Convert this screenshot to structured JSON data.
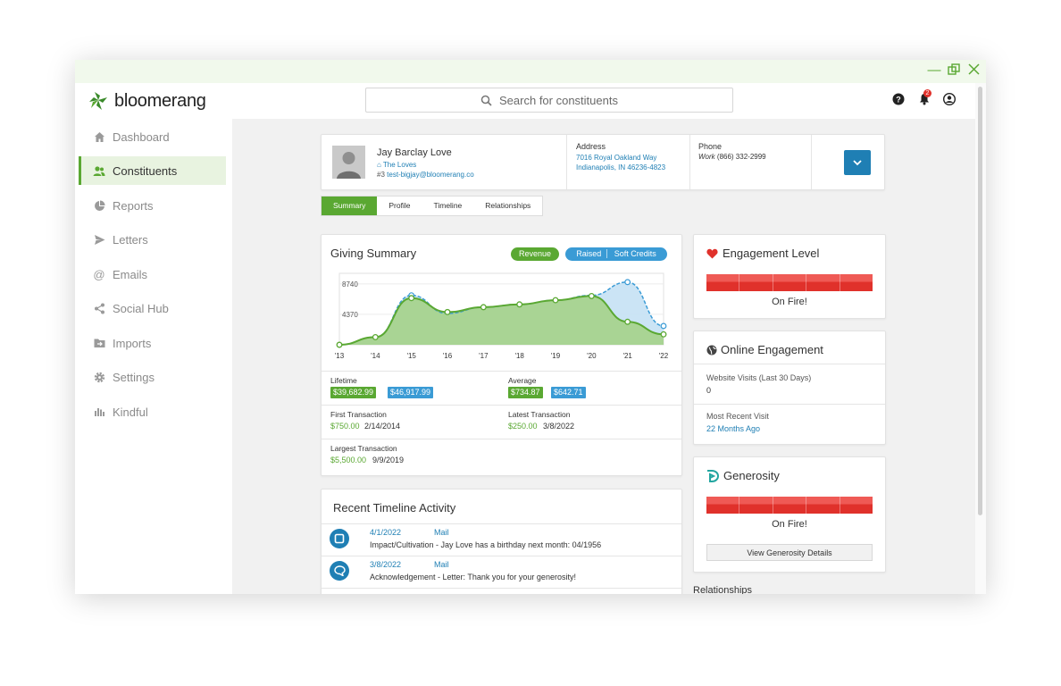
{
  "app": {
    "name": "bloomerang"
  },
  "search": {
    "placeholder": "Search for constituents"
  },
  "notifications": {
    "count": "2"
  },
  "sidebar": {
    "items": [
      {
        "label": "Dashboard",
        "icon": "home-icon"
      },
      {
        "label": "Constituents",
        "icon": "people-icon",
        "active": true
      },
      {
        "label": "Reports",
        "icon": "pie-chart-icon"
      },
      {
        "label": "Letters",
        "icon": "send-icon"
      },
      {
        "label": "Emails",
        "icon": "at-icon"
      },
      {
        "label": "Social Hub",
        "icon": "share-icon"
      },
      {
        "label": "Imports",
        "icon": "folder-import-icon"
      },
      {
        "label": "Settings",
        "icon": "gear-icon"
      },
      {
        "label": "Kindful",
        "icon": "bars-icon"
      }
    ]
  },
  "constituent": {
    "name": "Jay Barclay Love",
    "household": "The Loves",
    "number": "#3",
    "email": "test-bigjay@bloomerang.co",
    "address_label": "Address",
    "address_line1": "7016 Royal Oakland Way",
    "address_line2": "Indianapolis, IN 46236-4823",
    "phone_label": "Phone",
    "phone_type": "Work",
    "phone": "(866) 332-2999"
  },
  "tabs": [
    "Summary",
    "Profile",
    "Timeline",
    "Relationships"
  ],
  "giving": {
    "title": "Giving Summary",
    "revenue_label": "Revenue",
    "raised_label": "Raised",
    "soft_credits_label": "Soft Credits",
    "lifetime_label": "Lifetime",
    "lifetime_revenue": "$39,682.99",
    "lifetime_raised": "$46,917.99",
    "average_label": "Average",
    "average_revenue": "$734.87",
    "average_raised": "$642.71",
    "first_label": "First Transaction",
    "first_amount": "$750.00",
    "first_date": "2/14/2014",
    "latest_label": "Latest Transaction",
    "latest_amount": "$250.00",
    "latest_date": "3/8/2022",
    "largest_label": "Largest Transaction",
    "largest_amount": "$5,500.00",
    "largest_date": "9/9/2019"
  },
  "chart_data": {
    "type": "area",
    "x": [
      "'13",
      "'14",
      "'15",
      "'16",
      "'17",
      "'18",
      "'19",
      "'20",
      "'21",
      "'22"
    ],
    "y_ticks": [
      4370,
      8740
    ],
    "ylim": [
      0,
      10000
    ],
    "series": [
      {
        "name": "Revenue",
        "color": "#5aa832",
        "values": [
          0,
          1100,
          6700,
          4700,
          5400,
          5800,
          6400,
          7000,
          3300,
          1500
        ]
      },
      {
        "name": "Raised",
        "color": "#3a9bd5",
        "values": [
          0,
          1100,
          7100,
          4500,
          5400,
          5800,
          6400,
          7100,
          9000,
          2700
        ]
      }
    ]
  },
  "recent": {
    "title": "Recent Timeline Activity",
    "items": [
      {
        "date": "4/1/2022",
        "type": "Mail",
        "desc": "Impact/Cultivation - Jay Love has a birthday next month: 04/1956",
        "icon": "square-icon"
      },
      {
        "date": "3/8/2022",
        "type": "Mail",
        "desc": "Acknowledgement - Letter: Thank you for your generosity!",
        "icon": "chat-bubble-icon"
      }
    ]
  },
  "engagement": {
    "title": "Engagement Level",
    "status": "On Fire!"
  },
  "online": {
    "title": "Online Engagement",
    "visits_label": "Website Visits (Last 30 Days)",
    "visits_value": "0",
    "recent_label": "Most Recent Visit",
    "recent_value": "22 Months Ago"
  },
  "generosity": {
    "title": "Generosity",
    "status": "On Fire!",
    "button": "View Generosity Details"
  },
  "relationships_peek": "Relationships",
  "colors": {
    "green": "#5aa832",
    "blue": "#1f7fb4",
    "red": "#e0312b",
    "raised_blue": "#3a9bd5"
  }
}
